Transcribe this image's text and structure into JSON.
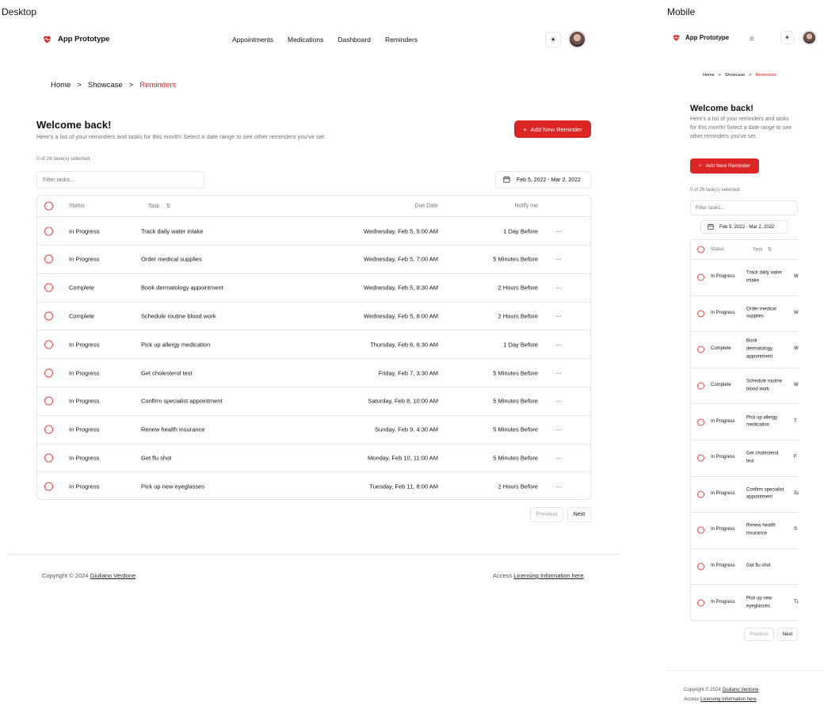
{
  "labels": {
    "desktop": "Desktop",
    "mobile": "Mobile"
  },
  "app": {
    "name": "App Prototype",
    "brand_color": "#dc2626"
  },
  "nav": [
    "Appointments",
    "Medications",
    "Dashboard",
    "Reminders"
  ],
  "icons": {
    "theme": "sun-icon",
    "menu": "menu-icon",
    "logo": "heart-pulse-icon",
    "calendar": "calendar-icon",
    "row_select": "circle-icon",
    "row_menu": "more-horizontal-icon",
    "sort": "sort-arrows-icon",
    "add": "plus-icon"
  },
  "breadcrumb": [
    "Home",
    "Showcase",
    "Reminders"
  ],
  "breadcrumb_sep": ">",
  "welcome": {
    "title": "Welcome back!",
    "subtitle": "Here's a list of your reminders and tasks for this month! Select a date range to see other reminders you've set."
  },
  "add_button": "Add New Reminder",
  "selected_text": "0 of 26 task(s) selected.",
  "filter_placeholder": "Filter tasks...",
  "date_range": "Feb 5, 2022 - Mar 2, 2022",
  "columns": {
    "status": "Status",
    "task": "Task",
    "due": "Due Date",
    "notify": "Notify me"
  },
  "rows": [
    {
      "status": "In Progress",
      "task": "Track daily water intake",
      "due": "Wednesday, Feb 5, 5:00 AM",
      "notify": "1 Day Before"
    },
    {
      "status": "In Progress",
      "task": "Order medical supplies",
      "due": "Wednesday, Feb 5, 7:00 AM",
      "notify": "5 Minutes Before"
    },
    {
      "status": "Complete",
      "task": "Book dermatology appointment",
      "due": "Wednesday, Feb 5, 9:30 AM",
      "notify": "2 Hours Before"
    },
    {
      "status": "Complete",
      "task": "Schedule routine blood work",
      "due": "Wednesday, Feb 5, 8:00 AM",
      "notify": "2 Hours Before"
    },
    {
      "status": "In Progress",
      "task": "Pick up allergy medication",
      "due": "Thursday, Feb 6, 6:30 AM",
      "notify": "1 Day Before"
    },
    {
      "status": "In Progress",
      "task": "Get cholesterol test",
      "due": "Friday, Feb 7, 3:30 AM",
      "notify": "5 Minutes Before"
    },
    {
      "status": "In Progress",
      "task": "Confirm specialist appointment",
      "due": "Saturday, Feb 8, 10:00 AM",
      "notify": "5 Minutes Before"
    },
    {
      "status": "In Progress",
      "task": "Renew health insurance",
      "due": "Sunday, Feb 9, 4:30 AM",
      "notify": "5 Minutes Before"
    },
    {
      "status": "In Progress",
      "task": "Get flu shot",
      "due": "Monday, Feb 10, 11:00 AM",
      "notify": "5 Minutes Before"
    },
    {
      "status": "In Progress",
      "task": "Pick up new eyeglasses",
      "due": "Tuesday, Feb 11, 8:00 AM",
      "notify": "2 Hours Before"
    }
  ],
  "mobile_rows": [
    {
      "status": "In Progress",
      "task": "Track daily water intake",
      "due": "W"
    },
    {
      "status": "In Progress",
      "task": "Order medical supplies",
      "due": "W"
    },
    {
      "status": "Complete",
      "task": "Book dermatology appointment",
      "due": "W"
    },
    {
      "status": "Complete",
      "task": "Schedule routine blood work",
      "due": "W"
    },
    {
      "status": "In Progress",
      "task": "Pick up allergy medication",
      "due": "T"
    },
    {
      "status": "In Progress",
      "task": "Get cholesterol test",
      "due": "F"
    },
    {
      "status": "In Progress",
      "task": "Confirm specialist appointment",
      "due": "Sa"
    },
    {
      "status": "In Progress",
      "task": "Renew health insurance",
      "due": "S"
    },
    {
      "status": "In Progress",
      "task": "Get flu shot",
      "due": ""
    },
    {
      "status": "In Progress",
      "task": "Pick up new eyeglasses",
      "due": "Tu"
    }
  ],
  "row_menu": "···",
  "pagination": {
    "previous": "Previous",
    "next": "Next"
  },
  "footer": {
    "copyright_prefix": "Copyright © 2024",
    "author": "Giuliano Verdone",
    "copyright_suffix": ".",
    "license_prefix": "Access",
    "license_link": "Licensing Information here",
    "license_suffix": "."
  }
}
